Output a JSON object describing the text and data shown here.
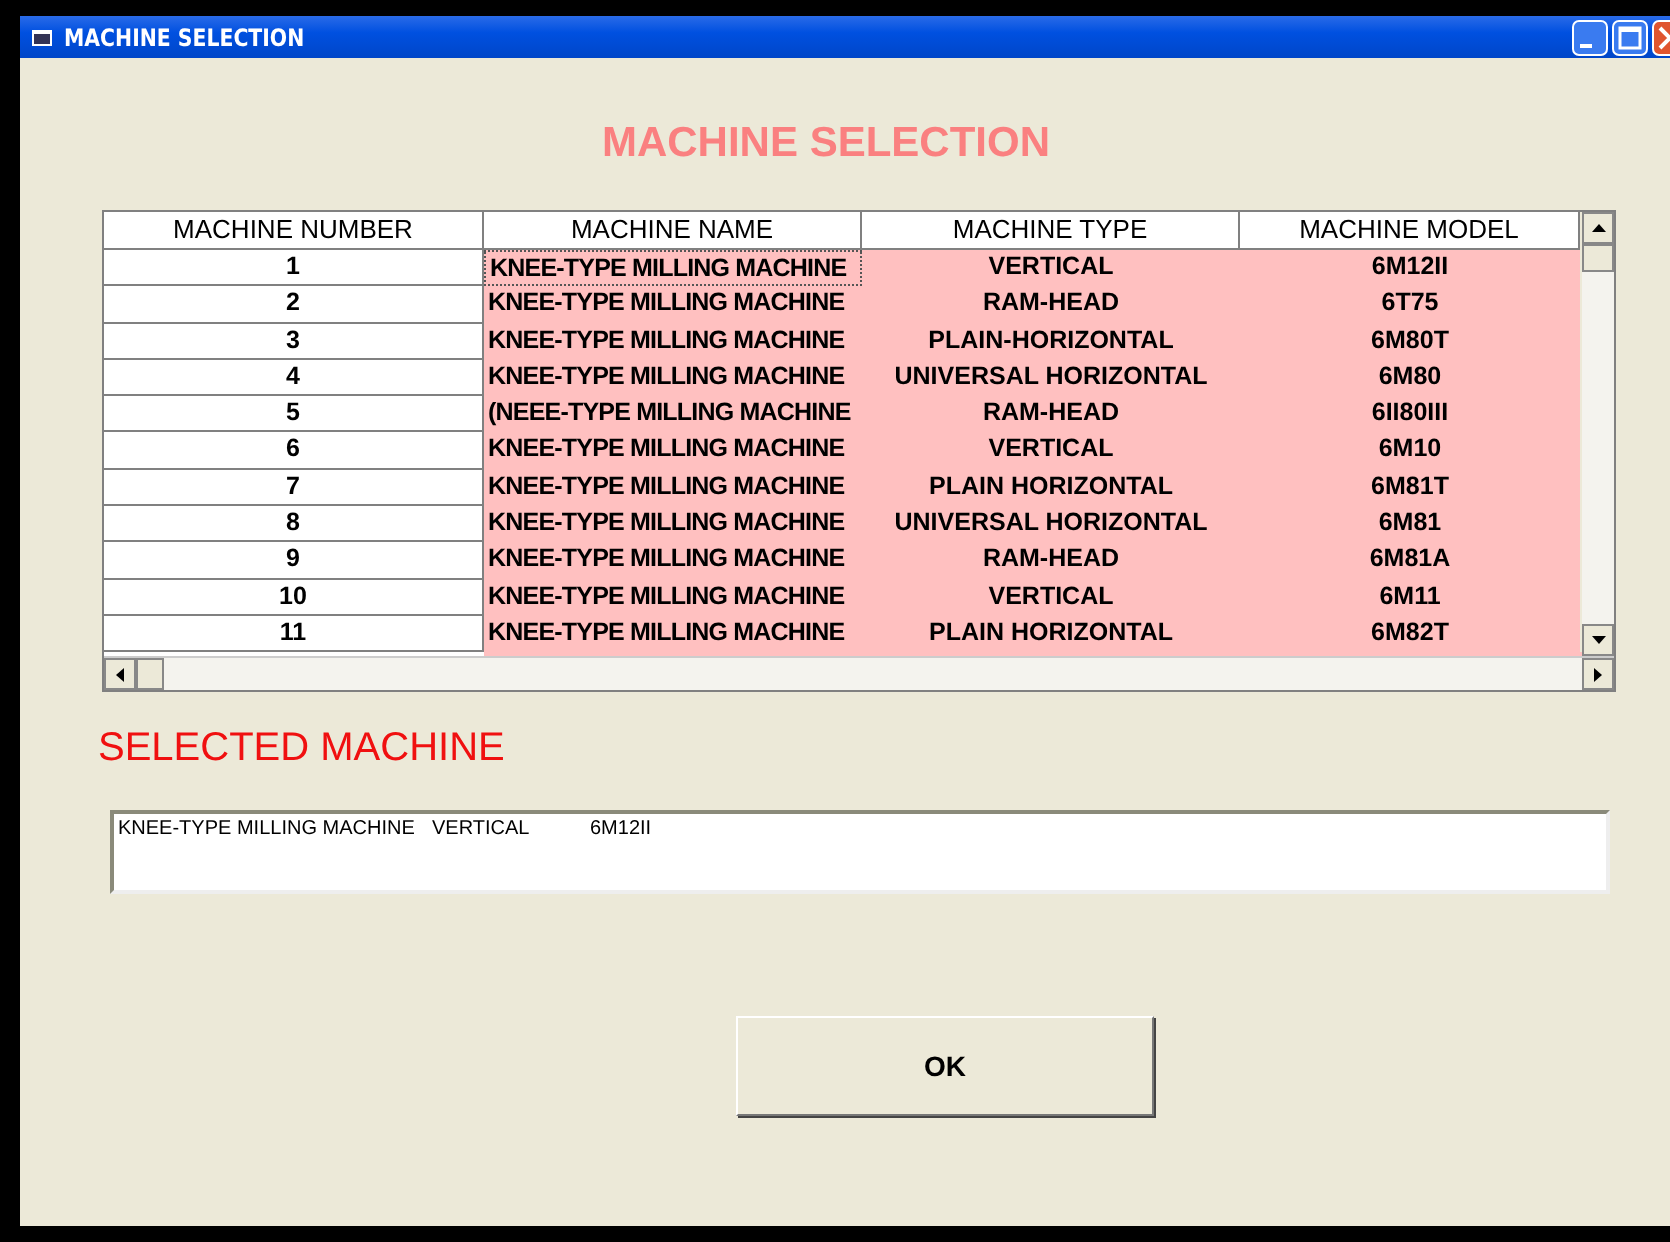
{
  "window": {
    "title": "MACHINE SELECTION"
  },
  "heading": "MACHINE SELECTION",
  "table": {
    "columns": [
      "MACHINE NUMBER",
      "MACHINE NAME",
      "MACHINE TYPE",
      "MACHINE MODEL"
    ],
    "rows": [
      {
        "cells": [
          "1",
          "KNEE-TYPE MILLING MACHINE",
          "VERTICAL",
          "6M12II"
        ],
        "selected": true
      },
      {
        "cells": [
          "2",
          "KNEE-TYPE MILLING MACHINE",
          "RAM-HEAD",
          "6T75"
        ],
        "selected": false
      },
      {
        "cells": [
          "3",
          "KNEE-TYPE MILLING MACHINE",
          "PLAIN-HORIZONTAL",
          "6M80T"
        ],
        "selected": false
      },
      {
        "cells": [
          "4",
          "KNEE-TYPE MILLING MACHINE",
          "UNIVERSAL HORIZONTAL",
          "6M80"
        ],
        "selected": false
      },
      {
        "cells": [
          "5",
          "(NEEE-TYPE MILLING MACHINE",
          "RAM-HEAD",
          "6II80III"
        ],
        "selected": false
      },
      {
        "cells": [
          "6",
          "KNEE-TYPE MILLING MACHINE",
          "VERTICAL",
          "6M10"
        ],
        "selected": false
      },
      {
        "cells": [
          "7",
          "KNEE-TYPE MILLING MACHINE",
          "PLAIN HORIZONTAL",
          "6M81T"
        ],
        "selected": false
      },
      {
        "cells": [
          "8",
          "KNEE-TYPE MILLING MACHINE",
          "UNIVERSAL HORIZONTAL",
          "6M81"
        ],
        "selected": false
      },
      {
        "cells": [
          "9",
          "KNEE-TYPE MILLING MACHINE",
          "RAM-HEAD",
          "6M81A"
        ],
        "selected": false
      },
      {
        "cells": [
          "10",
          "KNEE-TYPE MILLING MACHINE",
          "VERTICAL",
          "6M11"
        ],
        "selected": false
      },
      {
        "cells": [
          "11",
          "KNEE-TYPE MILLING MACHINE",
          "PLAIN HORIZONTAL",
          "6M82T"
        ],
        "selected": false
      }
    ]
  },
  "selected_label": "SELECTED MACHINE",
  "selected_machine": {
    "name": "KNEE-TYPE MILLING MACHINE",
    "type": "VERTICAL",
    "model": "6M12II"
  },
  "buttons": [
    "OK"
  ]
}
